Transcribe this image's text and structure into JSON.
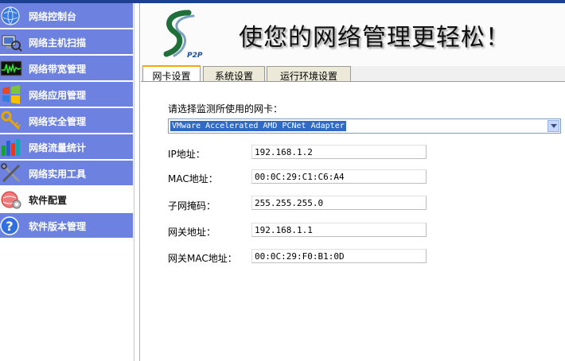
{
  "sidebar": {
    "items": [
      {
        "label": "网络控制台",
        "icon": "globe-icon"
      },
      {
        "label": "网络主机扫描",
        "icon": "computer-scan-icon"
      },
      {
        "label": "网络带宽管理",
        "icon": "bandwidth-monitor-icon"
      },
      {
        "label": "网络应用管理",
        "icon": "windows-flag-icon"
      },
      {
        "label": "网络安全管理",
        "icon": "security-key-icon"
      },
      {
        "label": "网络流量统计",
        "icon": "bar-chart-icon"
      },
      {
        "label": "网络实用工具",
        "icon": "tools-icon"
      },
      {
        "label": "软件配置",
        "icon": "settings-globe-icon"
      },
      {
        "label": "软件版本管理",
        "icon": "help-icon"
      }
    ],
    "active_index": 7
  },
  "banner": {
    "title": "使您的网络管理更轻松！",
    "logo_text": "P2P"
  },
  "tabs": [
    {
      "label": "网卡设置",
      "active": true
    },
    {
      "label": "系统设置",
      "active": false
    },
    {
      "label": "运行环境设置",
      "active": false
    }
  ],
  "form": {
    "adapter_prompt": "请选择监测所使用的网卡：",
    "adapter_selected": "VMware Accelerated AMD PCNet Adapter",
    "ip_label": "IP地址：",
    "ip_value": "192.168.1.2",
    "mac_label": "MAC地址：",
    "mac_value": "00:0C:29:C1:C6:A4",
    "subnet_label": "子网掩码：",
    "subnet_value": "255.255.255.0",
    "gateway_label": "网关地址：",
    "gateway_value": "192.168.1.1",
    "gateway_mac_label": "网关MAC地址：",
    "gateway_mac_value": "00:0C:29:F0:B1:0D"
  },
  "colors": {
    "nav_bg": "#6d82e0",
    "tab_active_accent": "#f2a900",
    "selection": "#316ac5"
  }
}
